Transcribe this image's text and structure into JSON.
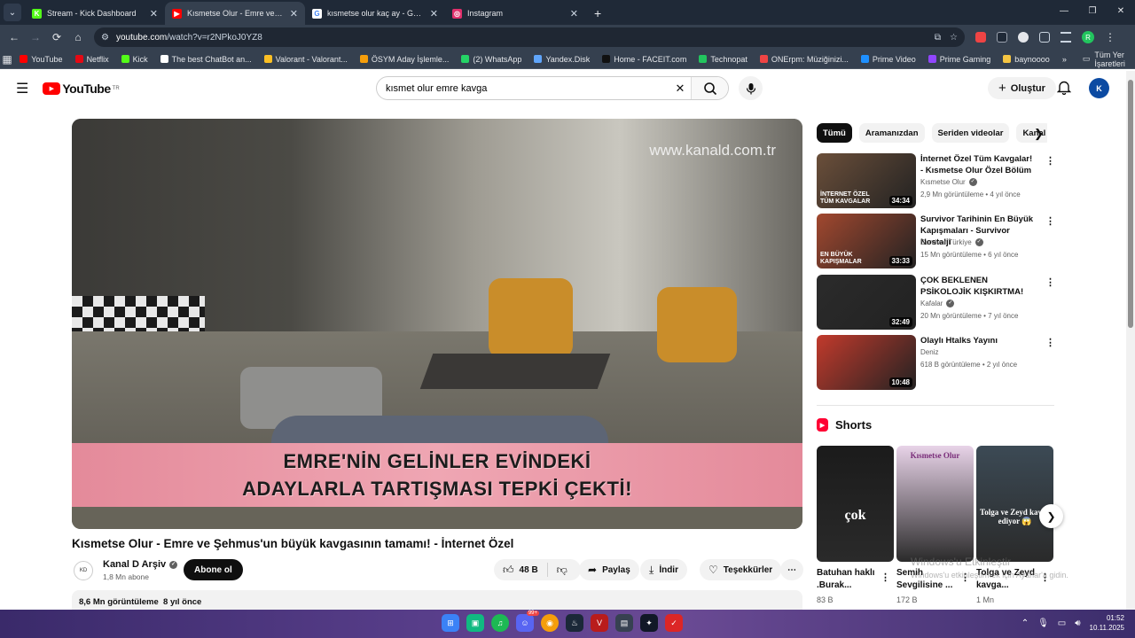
{
  "browser": {
    "tabs": [
      {
        "title": "Stream - Kick Dashboard",
        "favicon_color": "#53fc18",
        "favicon_glyph": "K",
        "active": false
      },
      {
        "title": "Kısmetse Olur - Emre ve Şehmu",
        "favicon_color": "#ff0000",
        "favicon_glyph": "▶",
        "active": true
      },
      {
        "title": "kısmetse olur kaç ay - Google'da",
        "favicon_color": "#ffffff",
        "favicon_glyph": "G",
        "active": false
      },
      {
        "title": "Instagram",
        "favicon_color": "#e1306c",
        "favicon_glyph": "◎",
        "active": false
      }
    ],
    "url_host": "youtube.com",
    "url_path": "/watch?v=r2NPkoJ0YZ8",
    "bookmarks": [
      {
        "label": "YouTube",
        "color": "#ff0000"
      },
      {
        "label": "Netflix",
        "color": "#e50914"
      },
      {
        "label": "Kick",
        "color": "#53fc18"
      },
      {
        "label": "The best ChatBot an...",
        "color": "#ffffff"
      },
      {
        "label": "Valorant - Valorant...",
        "color": "#fbbf24"
      },
      {
        "label": "ÖSYM Aday İşlemle...",
        "color": "#f59e0b"
      },
      {
        "label": "(2) WhatsApp",
        "color": "#25d366"
      },
      {
        "label": "Yandex.Disk",
        "color": "#60a5fa"
      },
      {
        "label": "Home - FACEIT.com",
        "color": "#111111"
      },
      {
        "label": "Technopat",
        "color": "#22c55e"
      },
      {
        "label": "ONErpm: Müziğinizi...",
        "color": "#ef4444"
      },
      {
        "label": "Prime Video",
        "color": "#1e90ff"
      },
      {
        "label": "Prime Gaming",
        "color": "#9146ff"
      },
      {
        "label": "baynoooo",
        "color": "#f5c542"
      }
    ],
    "all_bookmarks_label": "Tüm Yer İşaretleri",
    "profile_initial": "R"
  },
  "youtube": {
    "logo_text": "YouTube",
    "region": "TR",
    "search_value": "kısmet olur emre kavga",
    "create_label": "Oluştur",
    "avatar_text": "K"
  },
  "video": {
    "watermark": "www.kanald.com.tr",
    "banner_line1": "EMRE'NİN GELİNLER EVİNDEKİ",
    "banner_line2": "ADAYLARLA TARTIŞMASI TEPKİ ÇEKTİ!",
    "title": "Kısmetse Olur - Emre ve Şehmus'un büyük kavgasının tamamı! - İnternet Özel",
    "channel": "Kanal D Arşiv",
    "subscribers": "1,8 Mn abone",
    "subscribe_label": "Abone ol",
    "likes": "48 B",
    "share_label": "Paylaş",
    "download_label": "İndir",
    "thanks_label": "Teşekkürler",
    "views": "8,6 Mn görüntüleme",
    "age": "8 yıl önce"
  },
  "chips": [
    "Tümü",
    "Aramanızdan",
    "Seriden videolar",
    "Kanal"
  ],
  "recommendations": [
    {
      "title": "İnternet Özel Tüm Kavgalar! - Kısmetse Olur Özel Bölüm",
      "channel": "Kısmetse Olur",
      "meta": "2,9 Mn görüntüleme • 4 yıl önce",
      "duration": "34:34",
      "thumb_text": "İNTERNET ÖZEL TÜM KAVGALAR",
      "color": "#6b4f3a"
    },
    {
      "title": "Survivor Tarihinin En Büyük Kapışmaları - Survivor Nostalji",
      "channel": "Survivor Türkiye",
      "meta": "15 Mn görüntüleme • 6 yıl önce",
      "duration": "33:33",
      "thumb_text": "EN BÜYÜK KAPIŞMALAR",
      "color": "#a2482f"
    },
    {
      "title": "ÇOK BEKLENEN PSİKOLOJİK KIŞKIRTMA!",
      "channel": "Kafalar",
      "meta": "20 Mn görüntüleme • 7 yıl önce",
      "duration": "32:49",
      "thumb_text": "",
      "color": "#2b2b2b"
    },
    {
      "title": "Olaylı Htalks Yayını",
      "channel": "Deniz",
      "meta": "618 B görüntüleme • 2 yıl önce",
      "duration": "10:48",
      "thumb_text": "",
      "color": "#c23a2c"
    }
  ],
  "shorts": {
    "heading": "Shorts",
    "items": [
      {
        "title": "Batuhan haklı .Burak...",
        "views": "83 B",
        "overlay": "çok",
        "color": "#1b1b1b"
      },
      {
        "title": "Semih Sevgilisine ...",
        "views": "172 B",
        "overlay": "Kısmetse Olur",
        "color": "#e8d3e8"
      },
      {
        "title": "Tolga ve Zeyd kavga...",
        "views": "1 Mn",
        "overlay": "Tolga ve Zeyd kavga ediyor 😱",
        "color": "#3c4a55"
      }
    ]
  },
  "windows_notice": {
    "line1": "Windows'u Etkinleştir",
    "line2": "Windows'u etkinleştirmek için Ayarlar'a gidin."
  },
  "taskbar": {
    "time": "01:52",
    "date": "10.11.2025",
    "discord_badge": "99+"
  }
}
